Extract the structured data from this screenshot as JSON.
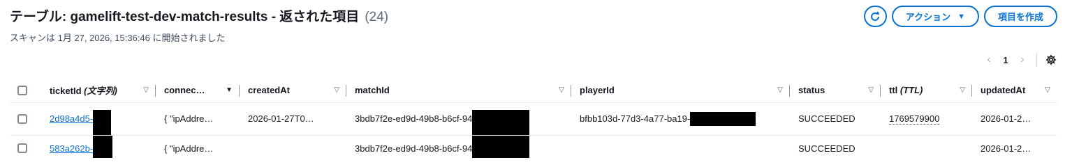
{
  "header": {
    "title": "テーブル: gamelift-test-dev-match-results - 返された項目",
    "count": "(24)",
    "scan_info": "スキャンは 1月 27, 2026, 15:36:46 に開始されました"
  },
  "actions": {
    "refresh_icon": "refresh-icon",
    "actions_label": "アクション",
    "create_label": "項目を作成"
  },
  "pagination": {
    "current_page": "1"
  },
  "table": {
    "columns": [
      {
        "main": "ticketId",
        "sub": "(文字列)"
      },
      {
        "main": "connec…",
        "sub": ""
      },
      {
        "main": "createdAt",
        "sub": ""
      },
      {
        "main": "matchId",
        "sub": ""
      },
      {
        "main": "playerId",
        "sub": ""
      },
      {
        "main": "status",
        "sub": ""
      },
      {
        "main": "ttl",
        "sub": "(TTL)"
      },
      {
        "main": "updatedAt",
        "sub": ""
      }
    ],
    "rows": [
      {
        "ticketId": "2d98a4d5-",
        "connection": "{ \"ipAddre…",
        "createdAt": "2026-01-27T0…",
        "matchId": "3bdb7f2e-ed9d-49b8-b6cf-94",
        "playerId": "bfbb103d-77d3-4a77-ba19-",
        "status": "SUCCEEDED",
        "ttl": "1769579900",
        "updatedAt": "2026-01-2…"
      },
      {
        "ticketId": "583a262b-",
        "connection": "{ \"ipAddre…",
        "createdAt": "",
        "matchId": "3bdb7f2e-ed9d-49b8-b6cf-94",
        "playerId": "",
        "status": "SUCCEEDED",
        "ttl": "",
        "updatedAt": "2026-01-2…"
      }
    ]
  },
  "colors": {
    "accent": "#0972d3",
    "text": "#16191f",
    "muted": "#5f6b7a"
  }
}
